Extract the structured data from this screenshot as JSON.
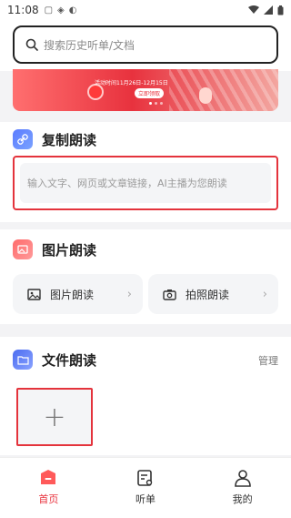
{
  "status_bar": {
    "time": "11:08"
  },
  "search": {
    "placeholder": "搜索历史听单/文档"
  },
  "banner": {
    "date_text": "活动时间11月26日-12月15日",
    "cta": "立即领取"
  },
  "copy_section": {
    "title": "复制朗读",
    "input_placeholder": "输入文字、网页或文章链接，AI主播为您朗读",
    "icon": "link-icon"
  },
  "picture_section": {
    "title": "图片朗读",
    "icon": "image-read-icon",
    "tiles": [
      {
        "label": "图片朗读",
        "icon": "image-icon"
      },
      {
        "label": "拍照朗读",
        "icon": "camera-icon"
      }
    ]
  },
  "file_section": {
    "title": "文件朗读",
    "manage_label": "管理",
    "add_symbol": "+",
    "icon": "file-icon"
  },
  "bottom_nav": [
    {
      "label": "首页",
      "icon": "home-icon",
      "active": true
    },
    {
      "label": "听单",
      "icon": "playlist-icon",
      "active": false
    },
    {
      "label": "我的",
      "icon": "profile-icon",
      "active": false
    }
  ],
  "colors": {
    "accent": "#e8323e",
    "blue": "#4b6cf0",
    "background": "#f3f3f5"
  }
}
